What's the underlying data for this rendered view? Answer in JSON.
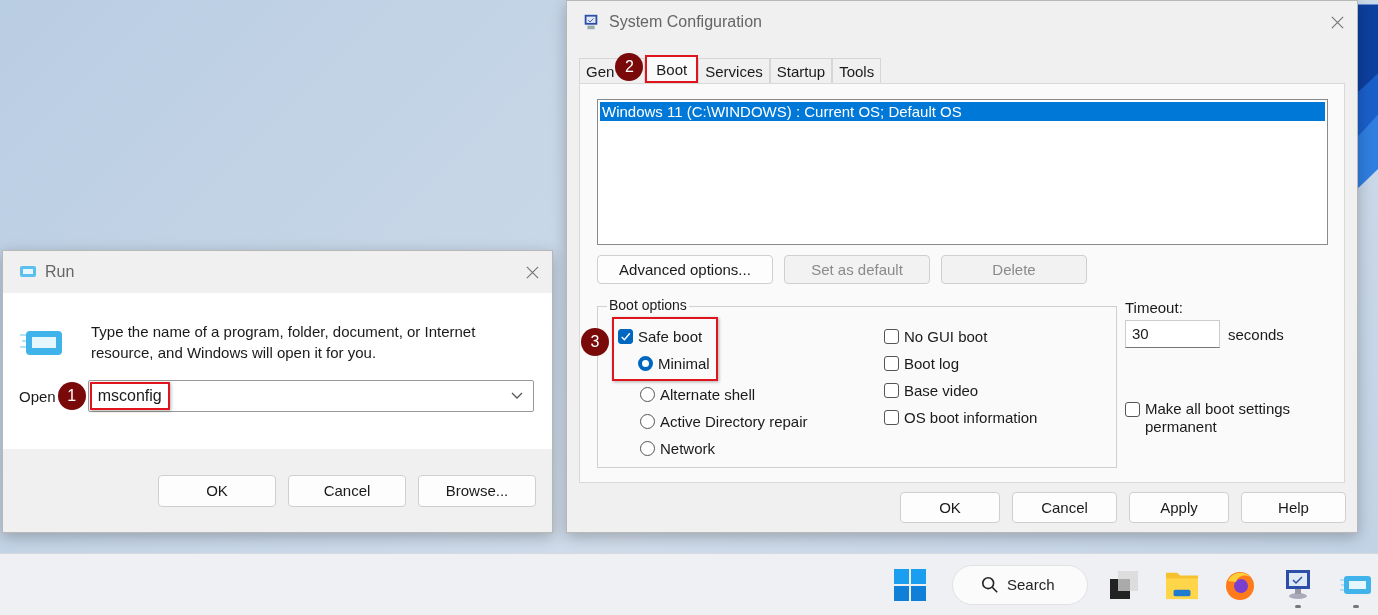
{
  "run_dialog": {
    "title": "Run",
    "description": "Type the name of a program, folder, document, or Internet resource, and Windows will open it for you.",
    "open_label": "Open",
    "open_value": "msconfig",
    "open_callout": "1",
    "buttons": [
      "OK",
      "Cancel",
      "Browse..."
    ]
  },
  "system_configuration": {
    "title": "System Configuration",
    "tabs": [
      {
        "label": "Gen",
        "selected": false
      },
      {
        "label": "Boot",
        "selected": true,
        "callout": "2"
      },
      {
        "label": "Services",
        "selected": false
      },
      {
        "label": "Startup",
        "selected": false
      },
      {
        "label": "Tools",
        "selected": false
      }
    ],
    "os_list": [
      {
        "label": "Windows 11 (C:\\WINDOWS) : Current OS; Default OS",
        "selected": true
      }
    ],
    "list_buttons": [
      {
        "label": "Advanced options...",
        "disabled": false
      },
      {
        "label": "Set as default",
        "disabled": true
      },
      {
        "label": "Delete",
        "disabled": true
      }
    ],
    "boot_options": {
      "title": "Boot options",
      "callout": "3",
      "safe_boot": {
        "label": "Safe boot",
        "checked": true
      },
      "safe_boot_modes": [
        {
          "label": "Minimal",
          "selected": true
        },
        {
          "label": "Alternate shell",
          "selected": false
        },
        {
          "label": "Active Directory repair",
          "selected": false
        },
        {
          "label": "Network",
          "selected": false
        }
      ],
      "flags": [
        {
          "label": "No GUI boot",
          "checked": false
        },
        {
          "label": "Boot log",
          "checked": false
        },
        {
          "label": "Base video",
          "checked": false
        },
        {
          "label": "OS boot information",
          "checked": false
        }
      ]
    },
    "timeout": {
      "label": "Timeout:",
      "value": "30",
      "unit": "seconds"
    },
    "make_permanent": {
      "label": "Make all boot settings permanent",
      "checked": false
    },
    "buttons": [
      "OK",
      "Cancel",
      "Apply",
      "Help"
    ]
  },
  "taskbar": {
    "search_label": "Search",
    "apps": [
      {
        "kind": "task-view",
        "running": false
      },
      {
        "kind": "file-explorer",
        "running": false
      },
      {
        "kind": "browser",
        "running": false
      },
      {
        "kind": "msconfig",
        "running": true
      },
      {
        "kind": "run",
        "running": true
      }
    ]
  }
}
